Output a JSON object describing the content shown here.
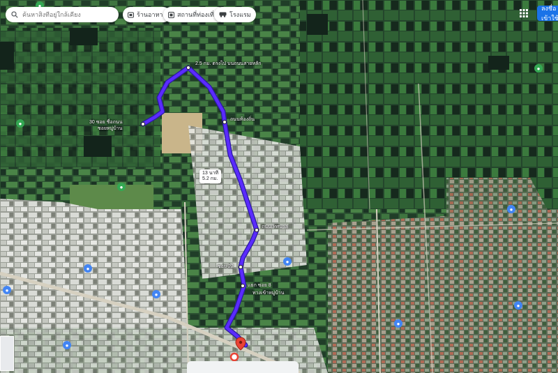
{
  "search": {
    "placeholder": "ค้นหาสิ่งที่อยู่ใกล้เคียง"
  },
  "chips": [
    {
      "label": "ร้านอาหาร",
      "icon": "restaurant-icon"
    },
    {
      "label": "สถานที่ท่องเที่ยว",
      "icon": "hotel-icon"
    },
    {
      "label": "โรงแรม",
      "icon": "transit-icon"
    }
  ],
  "header": {
    "signin_label": "ลงชื่อเข้าใช้"
  },
  "route": {
    "color": "#5b2bff",
    "duration_label": "13 นาที",
    "duration_sub": "5.2 กม.",
    "labels": [
      "2.5 กม. ตรงไป บนถนนสายหลัก",
      "ถนนท้องถิ่น",
      "30 ซอย ชื่อถนน",
      "ซอยหมู่บ้าน",
      "ถนนเทศบาล",
      "ซอย 22",
      "แยก ซอย 8",
      "ทางเข้าหมู่บ้าน"
    ]
  },
  "colors": {
    "field_dark": "#1e3a2a",
    "field_green": "#3c6b3a",
    "water": "#15281f",
    "urban": "#b8bcb5",
    "road": "#c8c3b4",
    "poi_green": "#34a853",
    "poi_blue": "#4285f4",
    "marker_red": "#ea4335"
  },
  "markers": {
    "destination": "destination-pin-icon",
    "origin": "origin-dot-icon"
  }
}
